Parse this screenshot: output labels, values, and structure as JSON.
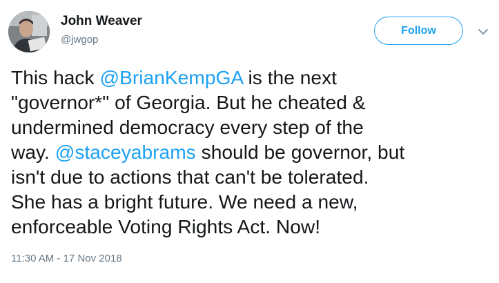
{
  "author": {
    "display_name": "John Weaver",
    "handle": "@jwgop"
  },
  "follow_button": {
    "label": "Follow"
  },
  "icons": {
    "menu": "chevron-down-icon",
    "avatar": "profile-photo"
  },
  "tweet": {
    "line1_pre": "This hack ",
    "mention1": "@BrianKempGA",
    "line1_post": " is the next",
    "line2": "\"governor*\" of Georgia. But he cheated &",
    "line3": "undermined democracy every step of the",
    "line4_pre": "way. ",
    "mention2": "@staceyabrams",
    "line4_post": " should be governor, but",
    "line5": "isn't due to actions that can't be tolerated.",
    "line6": "She has a bright future. We need a new,",
    "line7": "enforceable Voting Rights Act. Now!",
    "timestamp": "11:30 AM - 17 Nov 2018"
  },
  "colors": {
    "accent": "#1da1f2",
    "text": "#14171a",
    "secondary_text": "#657786"
  }
}
